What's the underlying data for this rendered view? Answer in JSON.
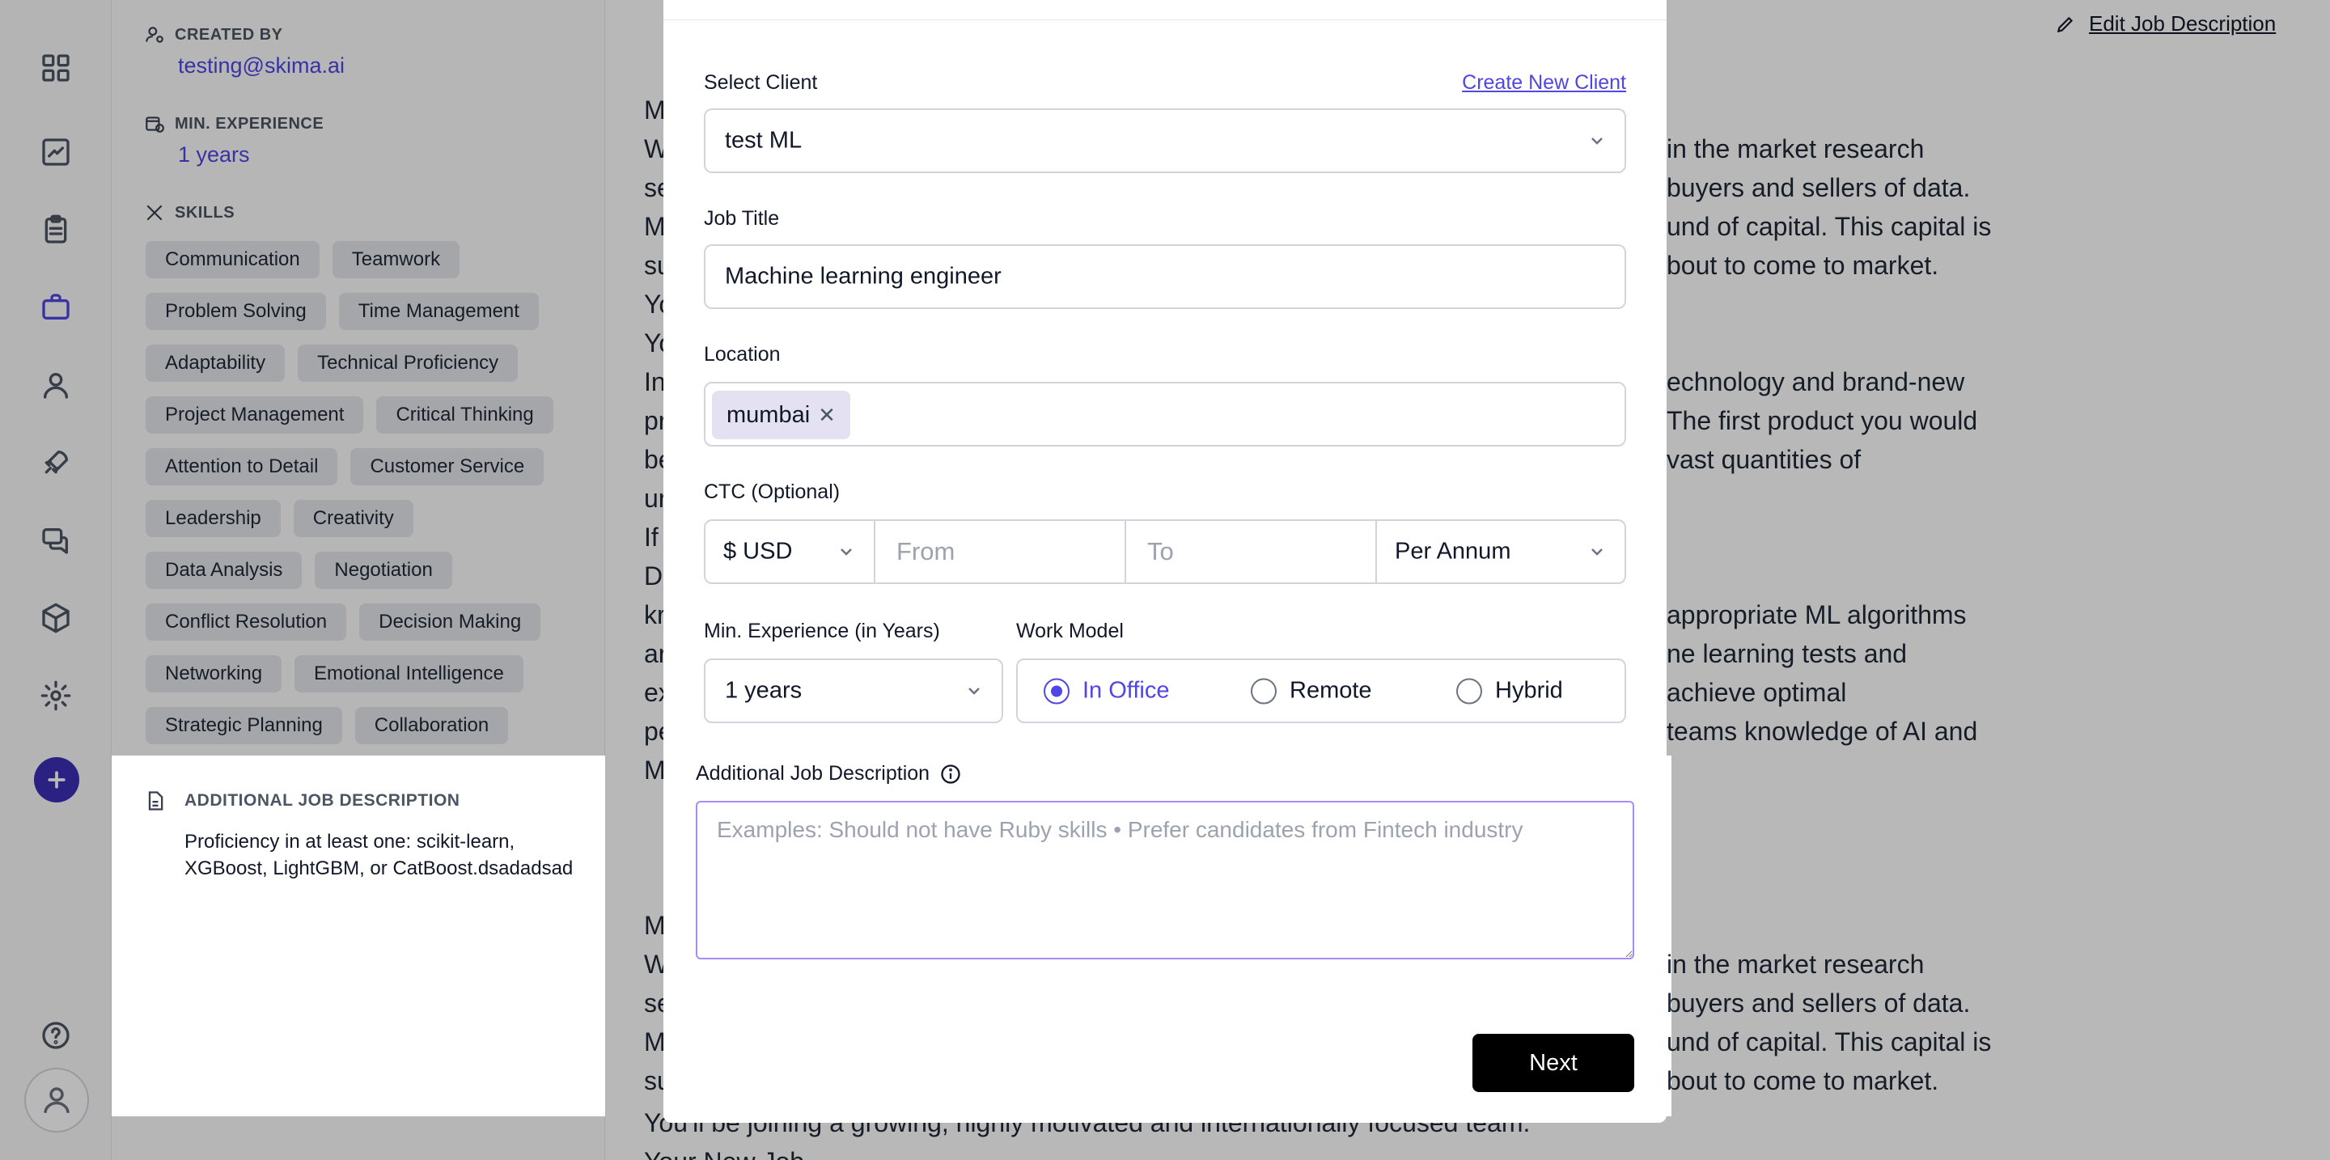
{
  "sidebar": {
    "icons": [
      "grid-icon",
      "trending-icon",
      "clipboard-icon",
      "briefcase-icon",
      "user-icon",
      "rocket-icon",
      "chat-icon",
      "cube-icon",
      "gear-icon",
      "help-icon",
      "avatar-icon"
    ]
  },
  "job_meta": {
    "created_by_label": "CREATED BY",
    "created_by_value": "testing@skima.ai",
    "min_exp_label": "MIN. EXPERIENCE",
    "min_exp_value": "1 years",
    "skills_label": "SKILLS",
    "skills": [
      "Communication",
      "Teamwork",
      "Problem Solving",
      "Time Management",
      "Adaptability",
      "Technical Proficiency",
      "Project Management",
      "Critical Thinking",
      "Attention to Detail",
      "Customer Service",
      "Leadership",
      "Creativity",
      "Data Analysis",
      "Negotiation",
      "Conflict Resolution",
      "Decision Making",
      "Networking",
      "Emotional Intelligence",
      "Strategic Planning",
      "Collaboration"
    ],
    "additional_label": "ADDITIONAL JOB DESCRIPTION",
    "additional_text": "Proficiency in at least one: scikit-learn, XGBoost, LightGBM, or CatBoost.dsadadsad"
  },
  "header": {
    "edit_link": "Edit Job Description"
  },
  "description": {
    "left_letters": [
      "M",
      "W",
      "se",
      "M",
      "su",
      "Yo",
      "Yo",
      "In",
      "pr",
      "be",
      "ur",
      "If",
      "D",
      "kr",
      "ar",
      "ex",
      "pe",
      "M"
    ],
    "right_lines": [
      "in the market research",
      "buyers and sellers of data.",
      "und of capital. This capital is",
      "bout to come to market.",
      "",
      "",
      "echnology and brand-new",
      "The first product you would",
      "vast quantities of",
      "",
      "",
      "",
      "appropriate ML algorithms",
      "ne learning tests and",
      "achieve optimal",
      "teams knowledge of AI and"
    ],
    "bottom_left_letters": [
      "M",
      "W",
      "se",
      "M",
      "su"
    ],
    "bottom_right_lines": [
      "in the market research",
      "buyers and sellers of data.",
      "und of capital. This capital is",
      "bout to come to market."
    ],
    "bottom_full_1": "You'll be joining a growing, highly motivated and internationally focused team.",
    "bottom_full_2": "Your New Job"
  },
  "modal": {
    "select_client_label": "Select Client",
    "create_client_link": "Create New Client",
    "client_value": "test ML",
    "job_title_label": "Job Title",
    "job_title_value": "Machine learning engineer",
    "location_label": "Location",
    "location_tag": "mumbai",
    "ctc_label": "CTC (Optional)",
    "currency_value": "$ USD",
    "from_placeholder": "From",
    "to_placeholder": "To",
    "period_value": "Per Annum",
    "min_exp_label": "Min. Experience (in Years)",
    "min_exp_value": "1 years",
    "work_model_label": "Work Model",
    "work_model_options": [
      "In Office",
      "Remote",
      "Hybrid"
    ],
    "work_model_selected": "In Office",
    "additional_label": "Additional Job Description",
    "additional_placeholder": "Examples: Should not have Ruby skills • Prefer candidates from Fintech industry",
    "next_label": "Next"
  },
  "colors": {
    "accent": "#4f46e5",
    "add_button": "#3b2fb5",
    "primary_button": "#000000"
  }
}
